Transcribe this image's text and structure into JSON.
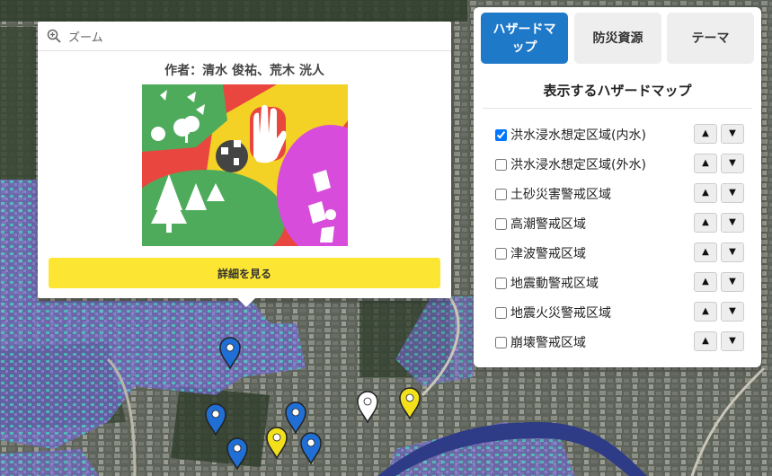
{
  "popup": {
    "zoom_label": "ズーム",
    "author": "作者：清水 俊祐、荒木 洸人",
    "detail_button": "詳細を見る"
  },
  "panel": {
    "tabs": [
      {
        "label": "ハザードマップ",
        "active": true
      },
      {
        "label": "防災資源",
        "active": false
      },
      {
        "label": "テーマ",
        "active": false
      }
    ],
    "title": "表示するハザードマップ",
    "layers": [
      {
        "label": "洪水浸水想定区域(内水)",
        "checked": true
      },
      {
        "label": "洪水浸水想定区域(外水)",
        "checked": false
      },
      {
        "label": "土砂災害警戒区域",
        "checked": false
      },
      {
        "label": "高潮警戒区域",
        "checked": false
      },
      {
        "label": "津波警戒区域",
        "checked": false
      },
      {
        "label": "地震動警戒区域",
        "checked": false
      },
      {
        "label": "地震火災警戒区域",
        "checked": false
      },
      {
        "label": "崩壊警戒区域",
        "checked": false
      }
    ],
    "up_arrow": "▲",
    "down_arrow": "▼"
  },
  "markers": [
    {
      "color": "#1f6fd6"
    },
    {
      "color": "#1f6fd6"
    },
    {
      "color": "#1f6fd6"
    },
    {
      "color": "#1f6fd6"
    },
    {
      "color": "#1f6fd6"
    },
    {
      "color": "#f2e01b"
    },
    {
      "color": "#ffffff"
    },
    {
      "color": "#f2e01b"
    }
  ],
  "colors": {
    "accent": "#1f79c9",
    "button_yellow": "#fde633",
    "flood_purple": "#7a6fd0",
    "flood_cyan": "#3fc7c0",
    "river": "#2e3b86"
  }
}
